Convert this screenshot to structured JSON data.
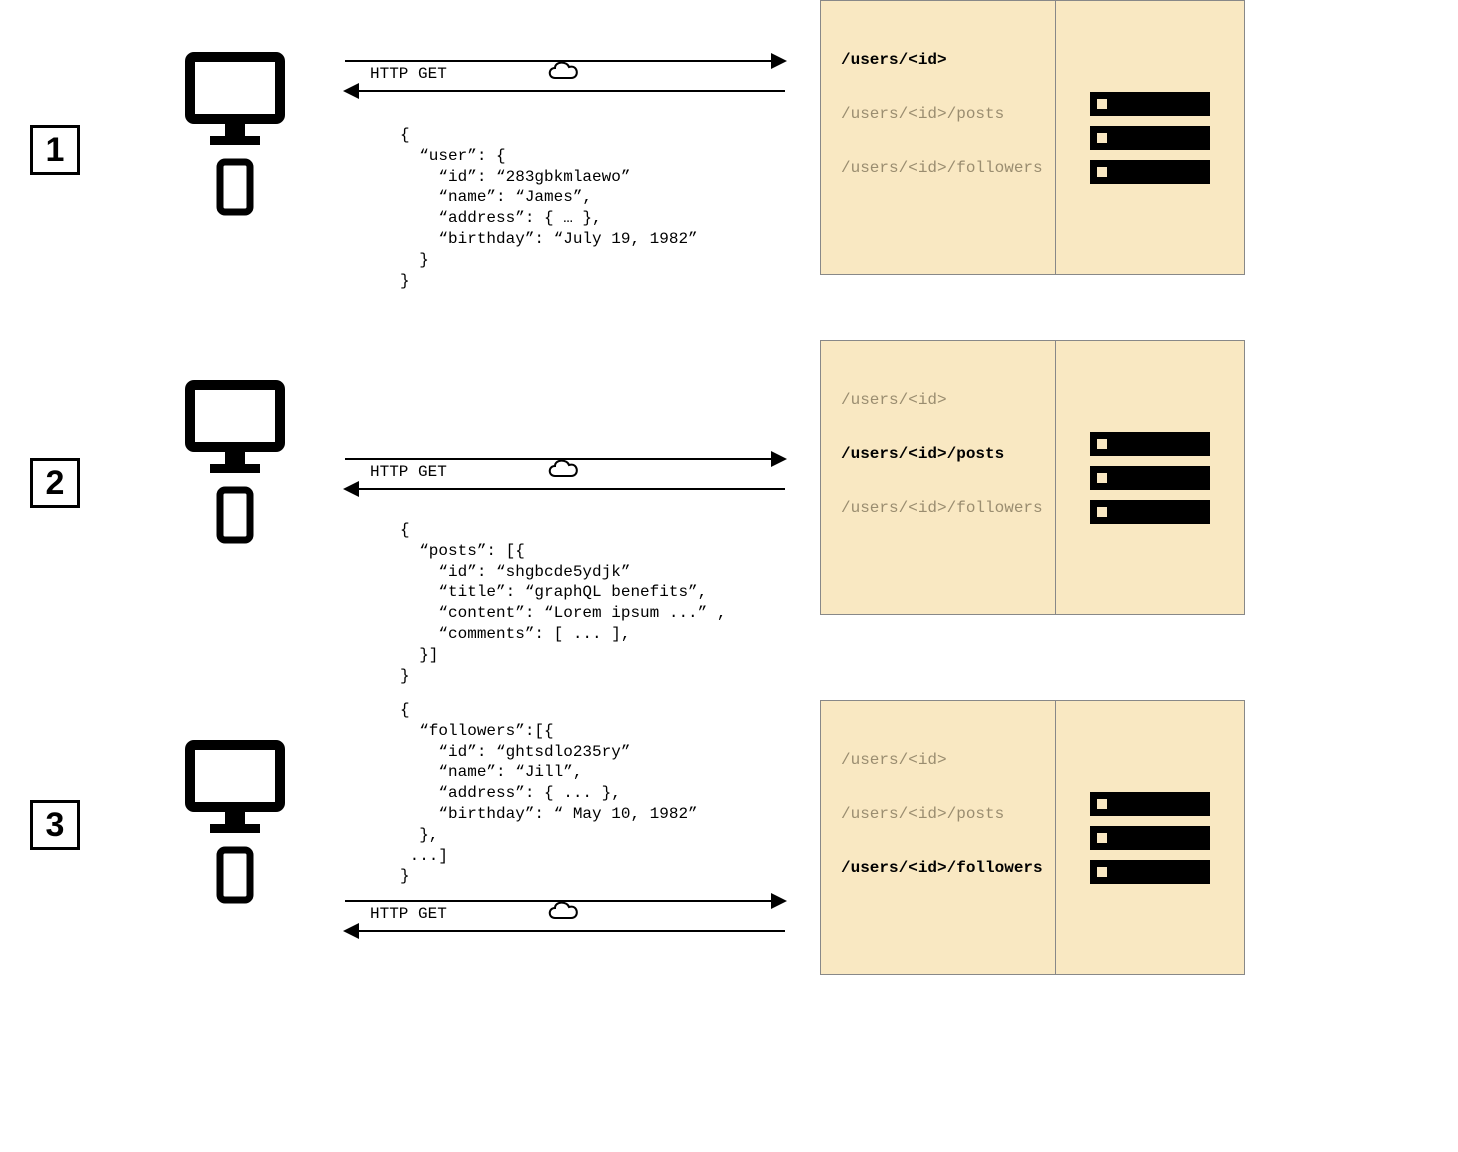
{
  "steps": {
    "one": {
      "number": "1",
      "http_label": "HTTP GET"
    },
    "two": {
      "number": "2",
      "http_label": "HTTP GET"
    },
    "three": {
      "number": "3",
      "http_label": "HTTP GET"
    }
  },
  "payloads": {
    "one": "{\n  “user”: {\n    “id”: “283gbkmlaewo”\n    “name”: “James”,\n    “address”: { … },\n    “birthday”: “July 19, 1982”\n  }\n}",
    "two": "{\n  “posts”: [{\n    “id”: “shgbcde5ydjk”\n    “title”: “graphQL benefits”,\n    “content”: “Lorem ipsum ...” ,\n    “comments”: [ ... ],\n  }]\n}",
    "three": "{\n  “followers”:[{\n    “id”: “ghtsdlo235ry”\n    “name”: “Jill”,\n    “address”: { ... },\n    “birthday”: “ May 10, 1982”\n  },\n ...]\n}"
  },
  "endpoints": {
    "users": "/users/<id>",
    "posts": "/users/<id>/posts",
    "followers": "/users/<id>/followers"
  }
}
